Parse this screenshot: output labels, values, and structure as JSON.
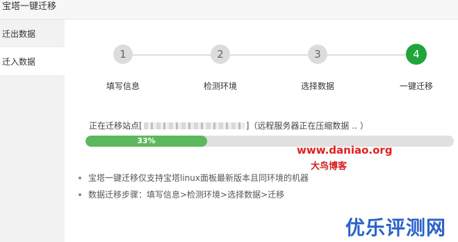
{
  "window": {
    "title": "宝塔一键迁移"
  },
  "sidebar": {
    "items": [
      {
        "label": "迁出数据",
        "active": false
      },
      {
        "label": "迁入数据",
        "active": true
      }
    ]
  },
  "steps": [
    {
      "number": "1",
      "label": "填写信息",
      "active": false
    },
    {
      "number": "2",
      "label": "检测环境",
      "active": false
    },
    {
      "number": "3",
      "label": "选择数据",
      "active": false
    },
    {
      "number": "4",
      "label": "一键迁移",
      "active": true
    }
  ],
  "status": {
    "prefix": "正在迁移站点[",
    "suffix": "]（远程服务器正在压缩数据 ‥ ）"
  },
  "progress": {
    "value": 0.33,
    "label": "33%"
  },
  "notes": [
    "宝塔一键迁移仅支持宝塔linux面板最新版本且同环境的机器",
    "数据迁移步骤：填写信息>检测环境>选择数据>迁移"
  ],
  "watermarks": {
    "site": "www.daniao.org",
    "name": "大鸟博客",
    "brand": "优乐评测网"
  },
  "colors": {
    "active_step": "#20a53a",
    "progress_fill": "#5cb85c",
    "watermark_red": "#e02020",
    "watermark_blue": "#2b62c8"
  }
}
